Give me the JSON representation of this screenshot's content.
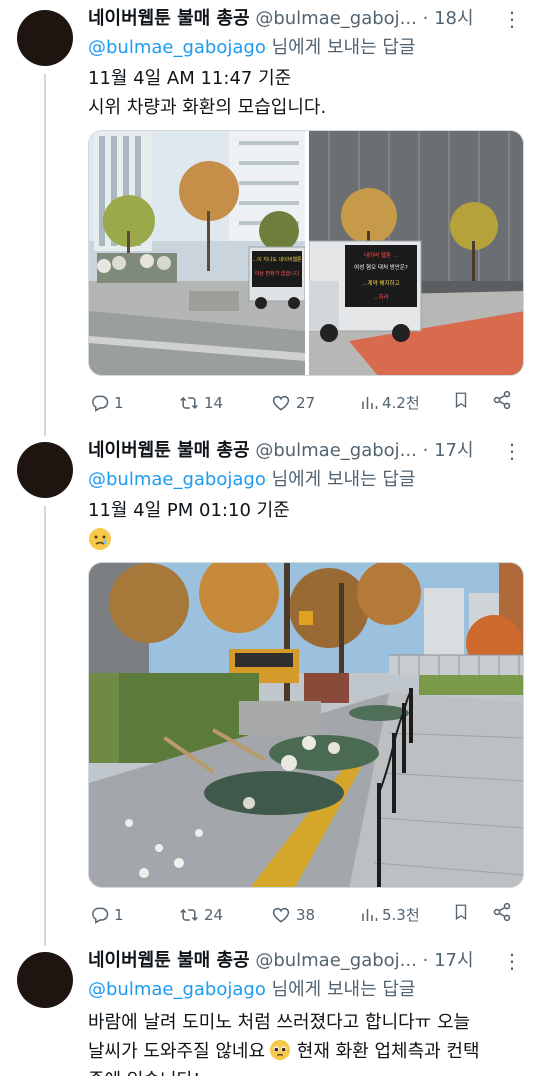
{
  "tweets": [
    {
      "name": "네이버웹툰 불매 총공",
      "handle": "@bulmae_gaboj...",
      "dot": "·",
      "time": "18시",
      "reply_prefix": "@bulmae_gabojago",
      "reply_suffix": " 님에게 보내는 답글",
      "lines": [
        "11월 4일 AM 11:47 기준",
        "시위 차량과 화환의 모습입니다."
      ],
      "truck_sign_left": [
        "...이 지나도 네이버웹툰",
        "이상 변화가 없습니다"
      ],
      "truck_sign_right": [
        "네이버 웹툰 ...",
        "여성 혐오 대처 방안은?",
        "...계약 해지하고",
        "...하라"
      ],
      "stats": {
        "replies": "1",
        "retweets": "14",
        "likes": "27",
        "views": "4.2천"
      }
    },
    {
      "name": "네이버웹툰 불매 총공",
      "handle": "@bulmae_gaboj...",
      "dot": "·",
      "time": "17시",
      "reply_prefix": "@bulmae_gabojago",
      "reply_suffix": " 님에게 보내는 답글",
      "lines": [
        "11월 4일 PM 01:10 기준"
      ],
      "emoji": "sad-face",
      "stats": {
        "replies": "1",
        "retweets": "24",
        "likes": "38",
        "views": "5.3천"
      }
    },
    {
      "name": "네이버웹툰 불매 총공",
      "handle": "@bulmae_gaboj...",
      "dot": "·",
      "time": "17시",
      "reply_prefix": "@bulmae_gabojago",
      "reply_suffix": " 님에게 보내는 답글",
      "line1": "바람에 날려 도미노 처럼 쓰러졌다고 합니다ㅠ 오늘",
      "line2_a": "날씨가 도와주질 않네요",
      "line2_b": " 현재 화환 업체측과 컨택",
      "line3": "중에 있습니다!"
    }
  ],
  "colors": {
    "text": "#0f1419",
    "muted": "#536471",
    "link": "#1d9bf0",
    "border": "#cfd9de",
    "avatar": "#1e1510"
  }
}
